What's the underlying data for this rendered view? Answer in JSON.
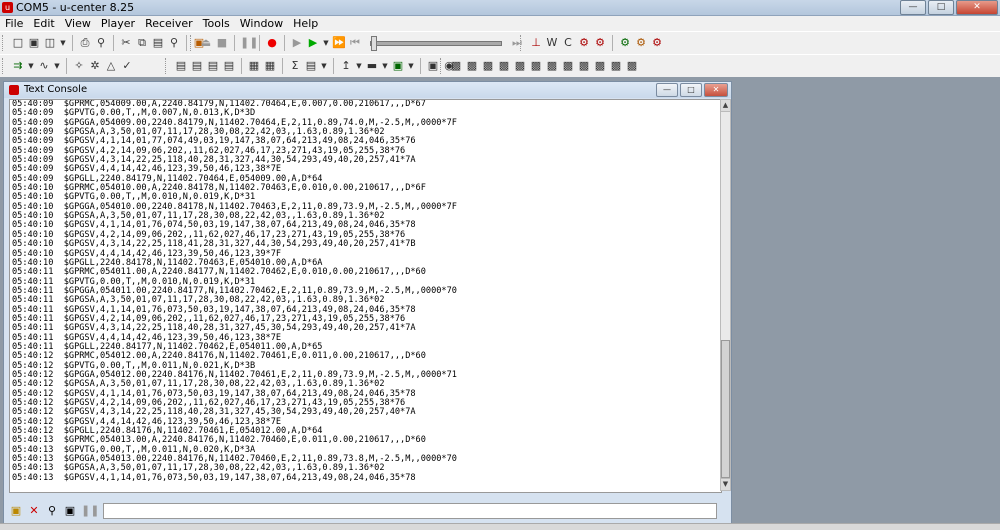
{
  "window": {
    "title": "COM5 - u-center 8.25"
  },
  "menu": [
    {
      "label": "File"
    },
    {
      "label": "Edit"
    },
    {
      "label": "View"
    },
    {
      "label": "Player"
    },
    {
      "label": "Receiver"
    },
    {
      "label": "Tools"
    },
    {
      "label": "Window"
    },
    {
      "label": "Help"
    }
  ],
  "console": {
    "title": "Text Console",
    "lines": [
      "05:40:09  $GPRMC,054009.00,A,2240.84179,N,11402.70464,E,0.007,0.00,210617,,,D*67",
      "05:40:09  $GPVTG,0.00,T,,M,0.007,N,0.013,K,D*3D",
      "05:40:09  $GPGGA,054009.00,2240.84179,N,11402.70464,E,2,11,0.89,74.0,M,-2.5,M,,0000*7F",
      "05:40:09  $GPGSA,A,3,50,01,07,11,17,28,30,08,22,42,03,,1.63,0.89,1.36*02",
      "05:40:09  $GPGSV,4,1,14,01,77,074,49,03,19,147,38,07,64,213,49,08,24,046,35*76",
      "05:40:09  $GPGSV,4,2,14,09,06,202,,11,62,027,46,17,23,271,43,19,05,255,38*76",
      "05:40:09  $GPGSV,4,3,14,22,25,118,40,28,31,327,44,30,54,293,49,40,20,257,41*7A",
      "05:40:09  $GPGSV,4,4,14,42,46,123,39,50,46,123,38*7E",
      "05:40:09  $GPGLL,2240.84179,N,11402.70464,E,054009.00,A,D*64",
      "05:40:10  $GPRMC,054010.00,A,2240.84178,N,11402.70463,E,0.010,0.00,210617,,,D*6F",
      "05:40:10  $GPVTG,0.00,T,,M,0.010,N,0.019,K,D*31",
      "05:40:10  $GPGGA,054010.00,2240.84178,N,11402.70463,E,2,11,0.89,73.9,M,-2.5,M,,0000*7F",
      "05:40:10  $GPGSA,A,3,50,01,07,11,17,28,30,08,22,42,03,,1.63,0.89,1.36*02",
      "05:40:10  $GPGSV,4,1,14,01,76,074,50,03,19,147,38,07,64,213,49,08,24,046,35*78",
      "05:40:10  $GPGSV,4,2,14,09,06,202,,11,62,027,46,17,23,271,43,19,05,255,38*76",
      "05:40:10  $GPGSV,4,3,14,22,25,118,41,28,31,327,44,30,54,293,49,40,20,257,41*7B",
      "05:40:10  $GPGSV,4,4,14,42,46,123,39,50,46,123,39*7F",
      "05:40:10  $GPGLL,2240.84178,N,11402.70463,E,054010.00,A,D*6A",
      "05:40:11  $GPRMC,054011.00,A,2240.84177,N,11402.70462,E,0.010,0.00,210617,,,D*60",
      "05:40:11  $GPVTG,0.00,T,,M,0.010,N,0.019,K,D*31",
      "05:40:11  $GPGGA,054011.00,2240.84177,N,11402.70462,E,2,11,0.89,73.9,M,-2.5,M,,0000*70",
      "05:40:11  $GPGSA,A,3,50,01,07,11,17,28,30,08,22,42,03,,1.63,0.89,1.36*02",
      "05:40:11  $GPGSV,4,1,14,01,76,073,50,03,19,147,38,07,64,213,49,08,24,046,35*78",
      "05:40:11  $GPGSV,4,2,14,09,06,202,,11,62,027,46,17,23,271,43,19,05,255,38*76",
      "05:40:11  $GPGSV,4,3,14,22,25,118,40,28,31,327,45,30,54,293,49,40,20,257,41*7A",
      "05:40:11  $GPGSV,4,4,14,42,46,123,39,50,46,123,38*7E",
      "05:40:11  $GPGLL,2240.84177,N,11402.70462,E,054011.00,A,D*65",
      "05:40:12  $GPRMC,054012.00,A,2240.84176,N,11402.70461,E,0.011,0.00,210617,,,D*60",
      "05:40:12  $GPVTG,0.00,T,,M,0.011,N,0.021,K,D*3B",
      "05:40:12  $GPGGA,054012.00,2240.84176,N,11402.70461,E,2,11,0.89,73.9,M,-2.5,M,,0000*71",
      "05:40:12  $GPGSA,A,3,50,01,07,11,17,28,30,08,22,42,03,,1.63,0.89,1.36*02",
      "05:40:12  $GPGSV,4,1,14,01,76,073,50,03,19,147,38,07,64,213,49,08,24,046,35*78",
      "05:40:12  $GPGSV,4,2,14,09,06,202,,11,62,027,46,17,23,271,43,19,05,255,38*76",
      "05:40:12  $GPGSV,4,3,14,22,25,118,40,28,31,327,45,30,54,293,49,40,20,257,40*7A",
      "05:40:12  $GPGSV,4,4,14,42,46,123,39,50,46,123,38*7E",
      "05:40:12  $GPGLL,2240.84176,N,11402.70461,E,054012.00,A,D*64",
      "05:40:13  $GPRMC,054013.00,A,2240.84176,N,11402.70460,E,0.011,0.00,210617,,,D*60",
      "05:40:13  $GPVTG,0.00,T,,M,0.011,N,0.020,K,D*3A",
      "05:40:13  $GPGGA,054013.00,2240.84176,N,11402.70460,E,2,11,0.89,73.8,M,-2.5,M,,0000*70",
      "05:40:13  $GPGSA,A,3,50,01,07,11,17,28,30,08,22,42,03,,1.63,0.89,1.36*02",
      "05:40:13  $GPGSV,4,1,14,01,76,073,50,03,19,147,38,07,64,213,49,08,24,046,35*78"
    ]
  }
}
